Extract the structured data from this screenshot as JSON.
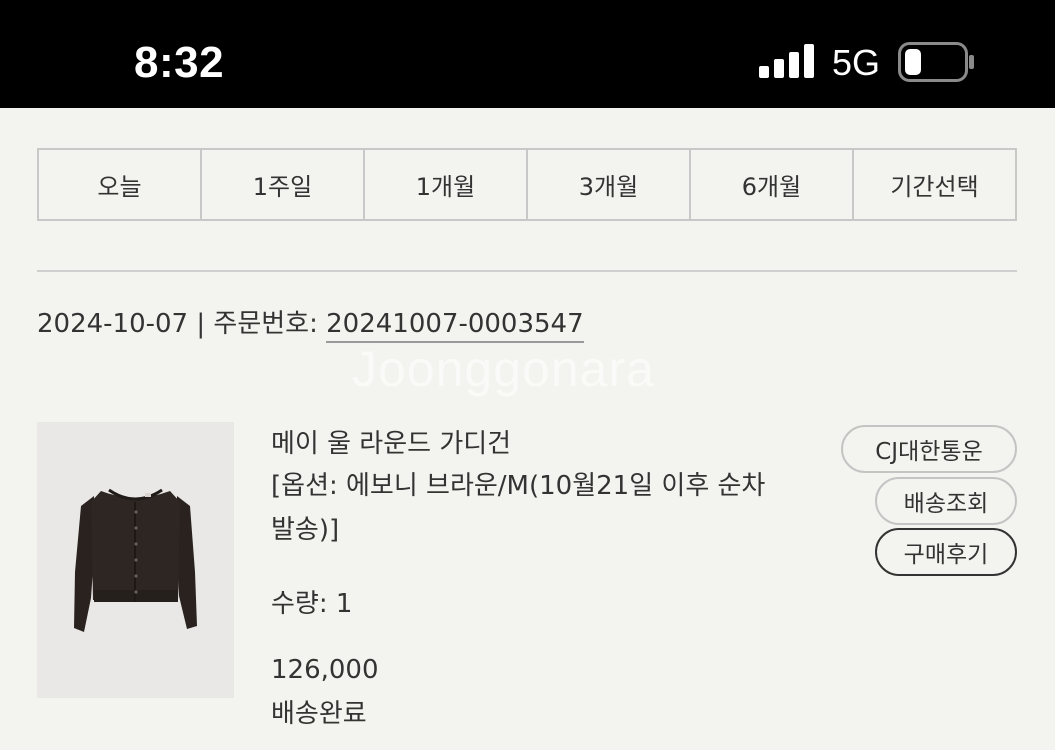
{
  "status_bar": {
    "time": "8:32",
    "network": "5G",
    "signal_icon": "signal-bars-icon",
    "battery_icon": "battery-low-icon",
    "battery_level": 0.2
  },
  "period_tabs": [
    {
      "label": "오늘"
    },
    {
      "label": "1주일"
    },
    {
      "label": "1개월"
    },
    {
      "label": "3개월"
    },
    {
      "label": "6개월"
    },
    {
      "label": "기간선택"
    }
  ],
  "order": {
    "date": "2024-10-07",
    "separator": " | ",
    "number_label": "주문번호: ",
    "number": "20241007-0003547"
  },
  "watermark": "Joonggonara",
  "product": {
    "image_icon": "cardigan-image",
    "name": "메이 울 라운드 가디건",
    "option": "[옵션: 에보니 브라운/M(10월21일 이후 순차발송)]",
    "quantity": "수량: 1",
    "price": "126,000",
    "status": "배송완료"
  },
  "actions": {
    "carrier": "CJ대한통운",
    "track": "배송조회",
    "review": "구매후기"
  },
  "colors": {
    "background": "#f3f3ef",
    "status_bar": "#000000",
    "text": "#333333",
    "border": "#c8c8c8"
  }
}
